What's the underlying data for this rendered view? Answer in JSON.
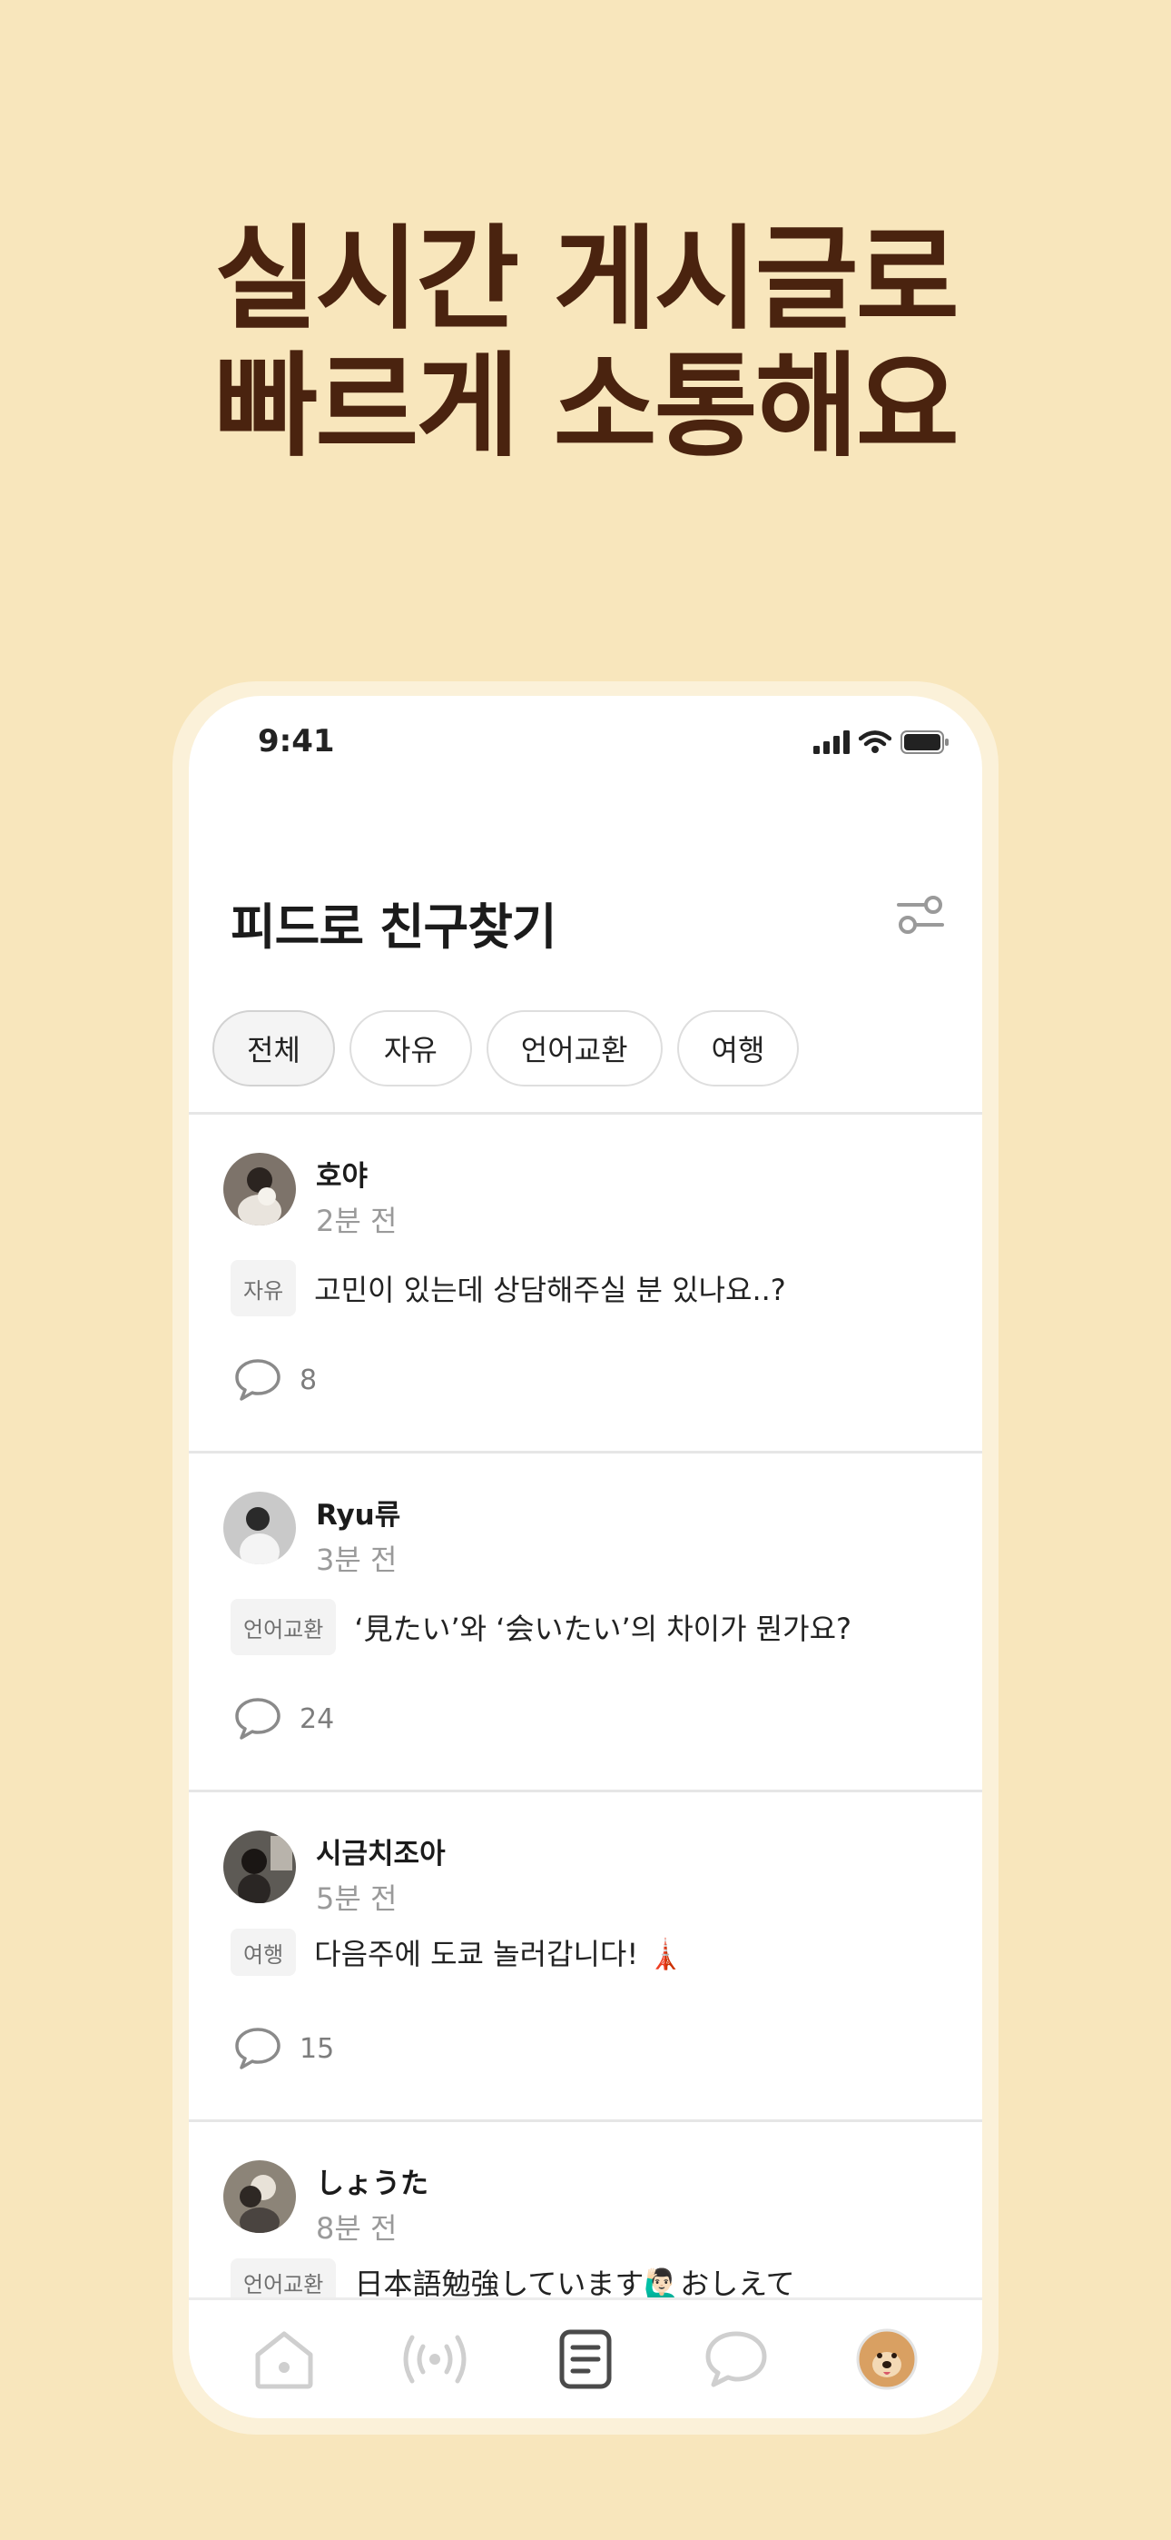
{
  "headline": {
    "line1": "실시간 게시글로",
    "line2": "빠르게 소통해요"
  },
  "status_bar": {
    "time": "9:41",
    "icons": [
      "signal-icon",
      "wifi-icon",
      "battery-icon"
    ]
  },
  "feed": {
    "title": "피드로 친구찾기",
    "filter_icon": "filter-icon",
    "chips": [
      {
        "label": "전체",
        "active": true
      },
      {
        "label": "자유",
        "active": false
      },
      {
        "label": "언어교환",
        "active": false
      },
      {
        "label": "여행",
        "active": false
      }
    ],
    "posts": [
      {
        "author": "호야",
        "time": "2분 전",
        "tag": "자유",
        "text": "고민이 있는데 상담해주실 분 있나요..?",
        "comments": "8"
      },
      {
        "author": "Ryu류",
        "time": "3분 전",
        "tag": "언어교환",
        "text": "‘見たい’와 ‘会いたい’의 차이가 뭔가요?",
        "comments": "24"
      },
      {
        "author": "시금치조아",
        "time": "5분 전",
        "tag": "여행",
        "text": "다음주에 도쿄 놀러갑니다! 🗼",
        "comments": "15"
      },
      {
        "author": "しょうた",
        "time": "8분 전",
        "tag": "언어교환",
        "text": "日本語勉強しています🙋🏻‍♂️おしえて",
        "comments": ""
      }
    ]
  },
  "tabbar": {
    "tabs": [
      "home-icon",
      "live-icon",
      "feed-icon",
      "chat-icon",
      "profile-avatar"
    ]
  },
  "colors": {
    "background": "#f8e6bc",
    "headline": "#4a230f",
    "phone_frame": "#fbf1d9"
  }
}
